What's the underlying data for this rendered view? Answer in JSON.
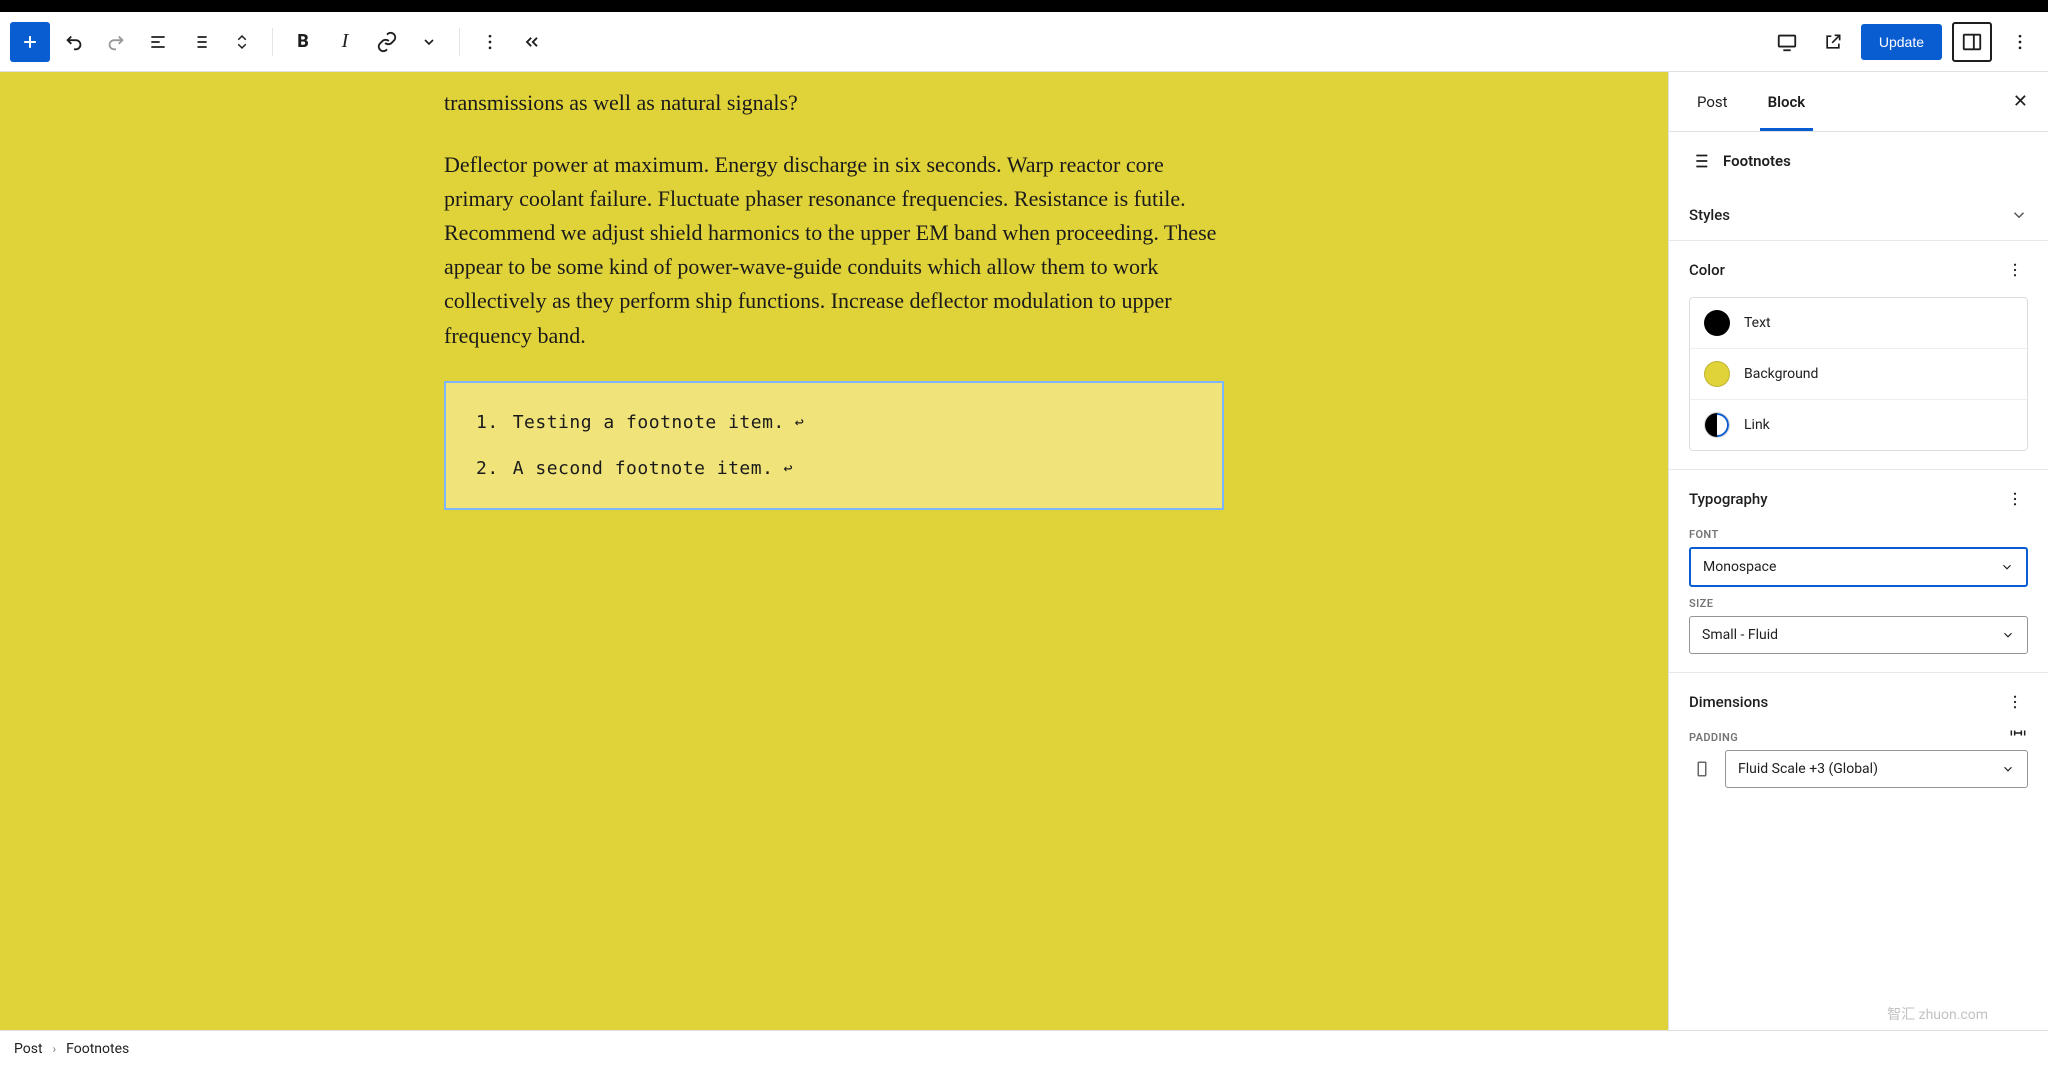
{
  "toolbar": {
    "update_label": "Update"
  },
  "sidebar": {
    "tabs": {
      "post": "Post",
      "block": "Block"
    },
    "block_name": "Footnotes",
    "styles": {
      "title": "Styles"
    },
    "color": {
      "title": "Color",
      "text_label": "Text",
      "background_label": "Background",
      "link_label": "Link"
    },
    "typography": {
      "title": "Typography",
      "font_label": "Font",
      "font_value": "Monospace",
      "size_label": "Size",
      "size_value": "Small - Fluid"
    },
    "dimensions": {
      "title": "Dimensions",
      "padding_label": "Padding",
      "padding_value": "Fluid Scale +3 (Global)"
    }
  },
  "content": {
    "p1": "transmissions as well as natural signals?",
    "p2": "Deflector power at maximum. Energy discharge in six seconds. Warp reactor core primary coolant failure. Fluctuate phaser resonance frequencies. Resistance is futile. Recommend we adjust shield harmonics to the upper EM band when proceeding. These appear to be some kind of power-wave-guide conduits which allow them to work collectively as they perform ship functions. Increase deflector modulation to upper frequency band.",
    "footnotes": [
      "Testing a footnote item.",
      "A second footnote item."
    ]
  },
  "breadcrumb": {
    "root": "Post",
    "current": "Footnotes"
  },
  "watermark": "智汇 zhuon.com"
}
